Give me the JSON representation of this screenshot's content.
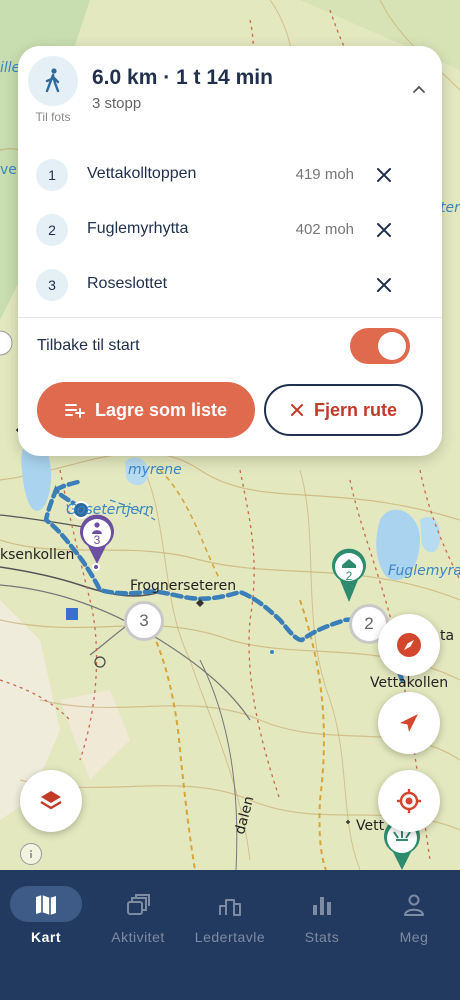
{
  "route": {
    "mode_label": "Til fots",
    "summary": "6.0 km · 1 t 14 min",
    "stops_count": "3 stopp",
    "stops": [
      {
        "number": "1",
        "name": "Vettakolltoppen",
        "elevation": "419 moh"
      },
      {
        "number": "2",
        "name": "Fuglemyrhytta",
        "elevation": "402 moh"
      },
      {
        "number": "3",
        "name": "Roseslottet",
        "elevation": ""
      }
    ],
    "return_to_start_label": "Tilbake til start",
    "return_to_start": true,
    "save_list_label": "Lagre som liste",
    "remove_route_label": "Fjern rute"
  },
  "map": {
    "labels": {
      "myrene": "myrene",
      "setertjern": "Gosetertjern",
      "sekollen": "ksenkollen",
      "frognerseteren": "Frognerseteren",
      "fuglemyra": "Fuglemyra",
      "vettakollen": "Vettakollen",
      "vett": "Vett",
      "ta": "ta",
      "dalen": "dalen",
      "lille": "ille",
      "veiv": "veiv",
      "ter": "ter"
    },
    "markers": {
      "stop3": "3",
      "stop2": "2",
      "cluster_a": "3",
      "cluster_b": "2"
    },
    "colors": {
      "route": "#3a7fb8",
      "accent": "#e06a4e",
      "navy": "#233a60",
      "stop_green": "#2e8b6e",
      "stop_purple": "#6b4fa0"
    }
  },
  "tabs": [
    {
      "label": "Kart",
      "icon": "map-icon",
      "active": true
    },
    {
      "label": "Aktivitet",
      "icon": "activity-icon",
      "active": false
    },
    {
      "label": "Ledertavle",
      "icon": "leaderboard-icon",
      "active": false
    },
    {
      "label": "Stats",
      "icon": "stats-icon",
      "active": false
    },
    {
      "label": "Meg",
      "icon": "profile-icon",
      "active": false
    }
  ]
}
